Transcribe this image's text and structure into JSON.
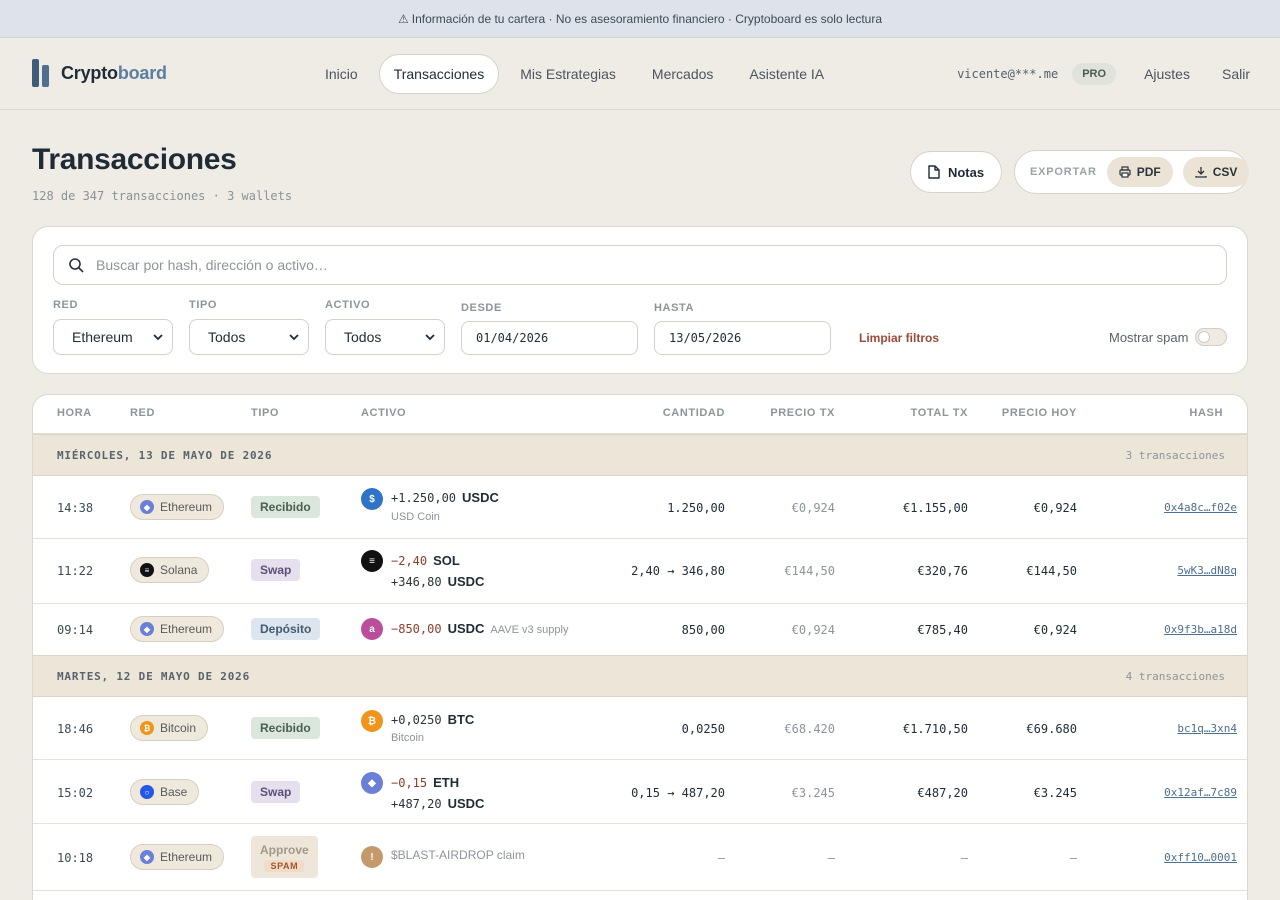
{
  "banner": {
    "text": "Información de tu cartera · No es asesoramiento financiero · Cryptoboard es solo lectura"
  },
  "brand": {
    "name_main": "Crypto",
    "name_accent": "board"
  },
  "nav": {
    "links": [
      "Inicio",
      "Transacciones",
      "Mis Estrategias",
      "Mercados",
      "Asistente IA"
    ],
    "active": "Transacciones",
    "user_email": "vicente@***.me",
    "plan_badge": "PRO",
    "settings": "Ajustes",
    "logout": "Salir"
  },
  "page": {
    "title": "Transacciones",
    "subtitle": "128 de 347 transacciones · 3 wallets",
    "notes_button": "Notas",
    "export_label": "EXPORTAR",
    "pdf_button": "PDF",
    "csv_button": "CSV"
  },
  "filters": {
    "search_placeholder": "Buscar por hash, dirección o activo…",
    "red_label": "RED",
    "red_value": "Ethereum",
    "tipo_label": "TIPO",
    "tipo_value": "Todos",
    "activo_label": "ACTIVO",
    "activo_value": "Todos",
    "desde_label": "DESDE",
    "desde_value": "01/04/2026",
    "hasta_label": "HASTA",
    "hasta_value": "13/05/2026",
    "clear": "Limpiar filtros",
    "spam_label": "Mostrar spam",
    "spam_on": false
  },
  "table": {
    "headers": [
      "HORA",
      "RED",
      "TIPO",
      "ACTIVO",
      "CANTIDAD",
      "PRECIO TX",
      "TOTAL TX",
      "PRECIO HOY",
      "HASH"
    ],
    "groups": [
      {
        "title": "MIÉRCOLES, 13 DE MAYO DE 2026",
        "count": "3 transacciones"
      },
      {
        "title": "MARTES, 12 DE MAYO DE 2026",
        "count": "4 transacciones"
      }
    ],
    "rows": [
      {
        "time": "14:38",
        "network": "Ethereum",
        "type": "Recibido",
        "amount": "+1.250,00",
        "symbol": "USDC",
        "sub": "USD Coin",
        "qty": "1.250,00",
        "price_tx": "€0,924",
        "total_tx": "€1.155,00",
        "price_today": "€0,924",
        "hash": "0x4a8c…f02e"
      },
      {
        "time": "11:22",
        "network": "Solana",
        "type": "Swap",
        "amount": "−2,40",
        "symbol": "SOL",
        "amount2": "+346,80",
        "symbol2": "USDC",
        "qty": "2,40 → 346,80",
        "price_tx": "€144,50",
        "total_tx": "€320,76",
        "price_today": "€144,50",
        "hash": "5wK3…dN8q"
      },
      {
        "time": "09:14",
        "network": "Ethereum",
        "type": "Depósito",
        "amount": "−850,00",
        "symbol": "USDC",
        "note": "AAVE v3 supply",
        "qty": "850,00",
        "price_tx": "€0,924",
        "total_tx": "€785,40",
        "price_today": "€0,924",
        "hash": "0x9f3b…a18d"
      },
      {
        "time": "18:46",
        "network": "Bitcoin",
        "type": "Recibido",
        "amount": "+0,0250",
        "symbol": "BTC",
        "sub": "Bitcoin",
        "qty": "0,0250",
        "price_tx": "€68.420",
        "total_tx": "€1.710,50",
        "price_today": "€69.680",
        "hash": "bc1q…3xn4"
      },
      {
        "time": "15:02",
        "network": "Base",
        "type": "Swap",
        "amount": "−0,15",
        "symbol": "ETH",
        "amount2": "+487,20",
        "symbol2": "USDC",
        "qty": "0,15 → 487,20",
        "price_tx": "€3.245",
        "total_tx": "€487,20",
        "price_today": "€3.245",
        "hash": "0x12af…7c89"
      },
      {
        "time": "10:18",
        "network": "Ethereum",
        "type": "Approve",
        "type_flag": "SPAM",
        "asset_text": "$BLAST-AIRDROP claim",
        "qty": "—",
        "price_tx": "—",
        "total_tx": "—",
        "price_today": "—",
        "hash": "0xff10…0001"
      }
    ]
  },
  "colors": {
    "accent": "#4f6f8e",
    "background": "#efece5",
    "negative": "#8a3f2c",
    "link": "#9a4a3a"
  }
}
